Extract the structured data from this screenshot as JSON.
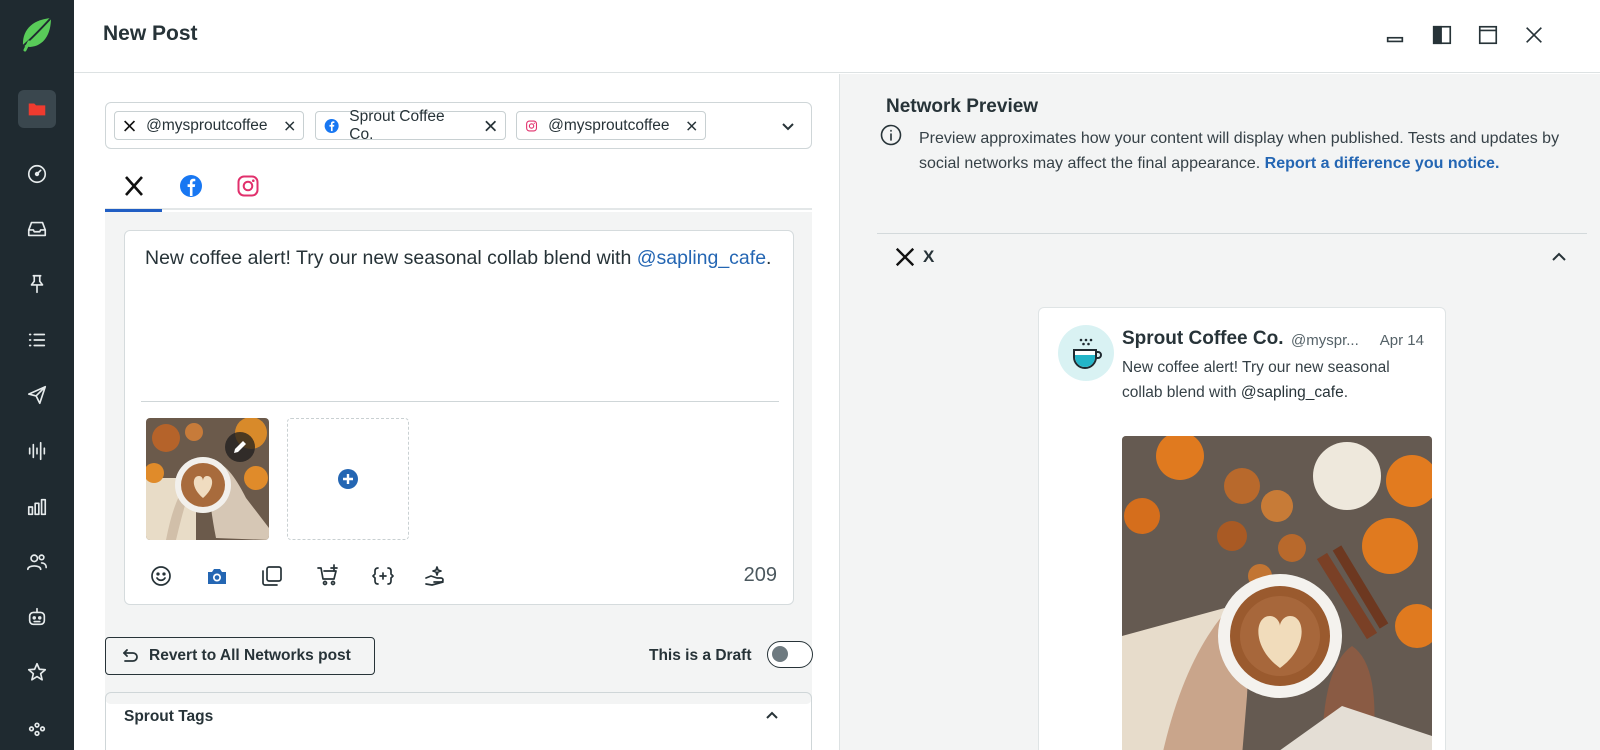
{
  "header": {
    "title": "New Post"
  },
  "sidebar": {
    "items": [
      {
        "name": "publishing",
        "icon": "folder-icon"
      },
      {
        "name": "dashboard",
        "icon": "gauge-icon"
      },
      {
        "name": "inbox",
        "icon": "inbox-icon"
      },
      {
        "name": "tasks",
        "icon": "pin-icon"
      },
      {
        "name": "lists",
        "icon": "list-icon"
      },
      {
        "name": "publish",
        "icon": "paper-plane-icon"
      },
      {
        "name": "listening",
        "icon": "audio-wave-icon"
      },
      {
        "name": "reports",
        "icon": "bar-chart-icon"
      },
      {
        "name": "people",
        "icon": "people-icon"
      },
      {
        "name": "automation",
        "icon": "bot-icon"
      },
      {
        "name": "reviews",
        "icon": "star-icon"
      },
      {
        "name": "apps",
        "icon": "apps-icon"
      }
    ]
  },
  "profiles": [
    {
      "network": "x",
      "label": "@mysproutcoffee"
    },
    {
      "network": "facebook",
      "label": "Sprout Coffee Co."
    },
    {
      "network": "instagram",
      "label": "@mysproutcoffee"
    }
  ],
  "composer": {
    "text_before": "New coffee alert! Try our new seasonal collab blend with ",
    "mention": "@sapling_cafe",
    "text_after": ".",
    "char_count": "209"
  },
  "actions": {
    "revert_label": "Revert to All Networks post",
    "draft_label": "This is a Draft",
    "draft_on": false
  },
  "tags_panel": {
    "title": "Sprout Tags"
  },
  "preview": {
    "title": "Network Preview",
    "desc": "Preview approximates how your content will display when published. Tests and updates by social networks may affect the final appearance. ",
    "link": "Report a difference you notice.",
    "network_name": "X",
    "tweet": {
      "name": "Sprout Coffee Co.",
      "handle": "@myspr...",
      "date": "Apr 14",
      "text_before": "New coffee alert! Try our new seasonal collab blend with ",
      "mention": "@sapling_cafe",
      "text_after": "."
    }
  },
  "colors": {
    "sidebar_bg": "#1f2a30",
    "active_nav": "#e8382f",
    "accent_blue": "#205ec4",
    "link_blue": "#2466b3",
    "facebook_blue": "#1877f2",
    "instagram_pink": "#e1306c",
    "preview_bg": "#f3f4f4"
  }
}
